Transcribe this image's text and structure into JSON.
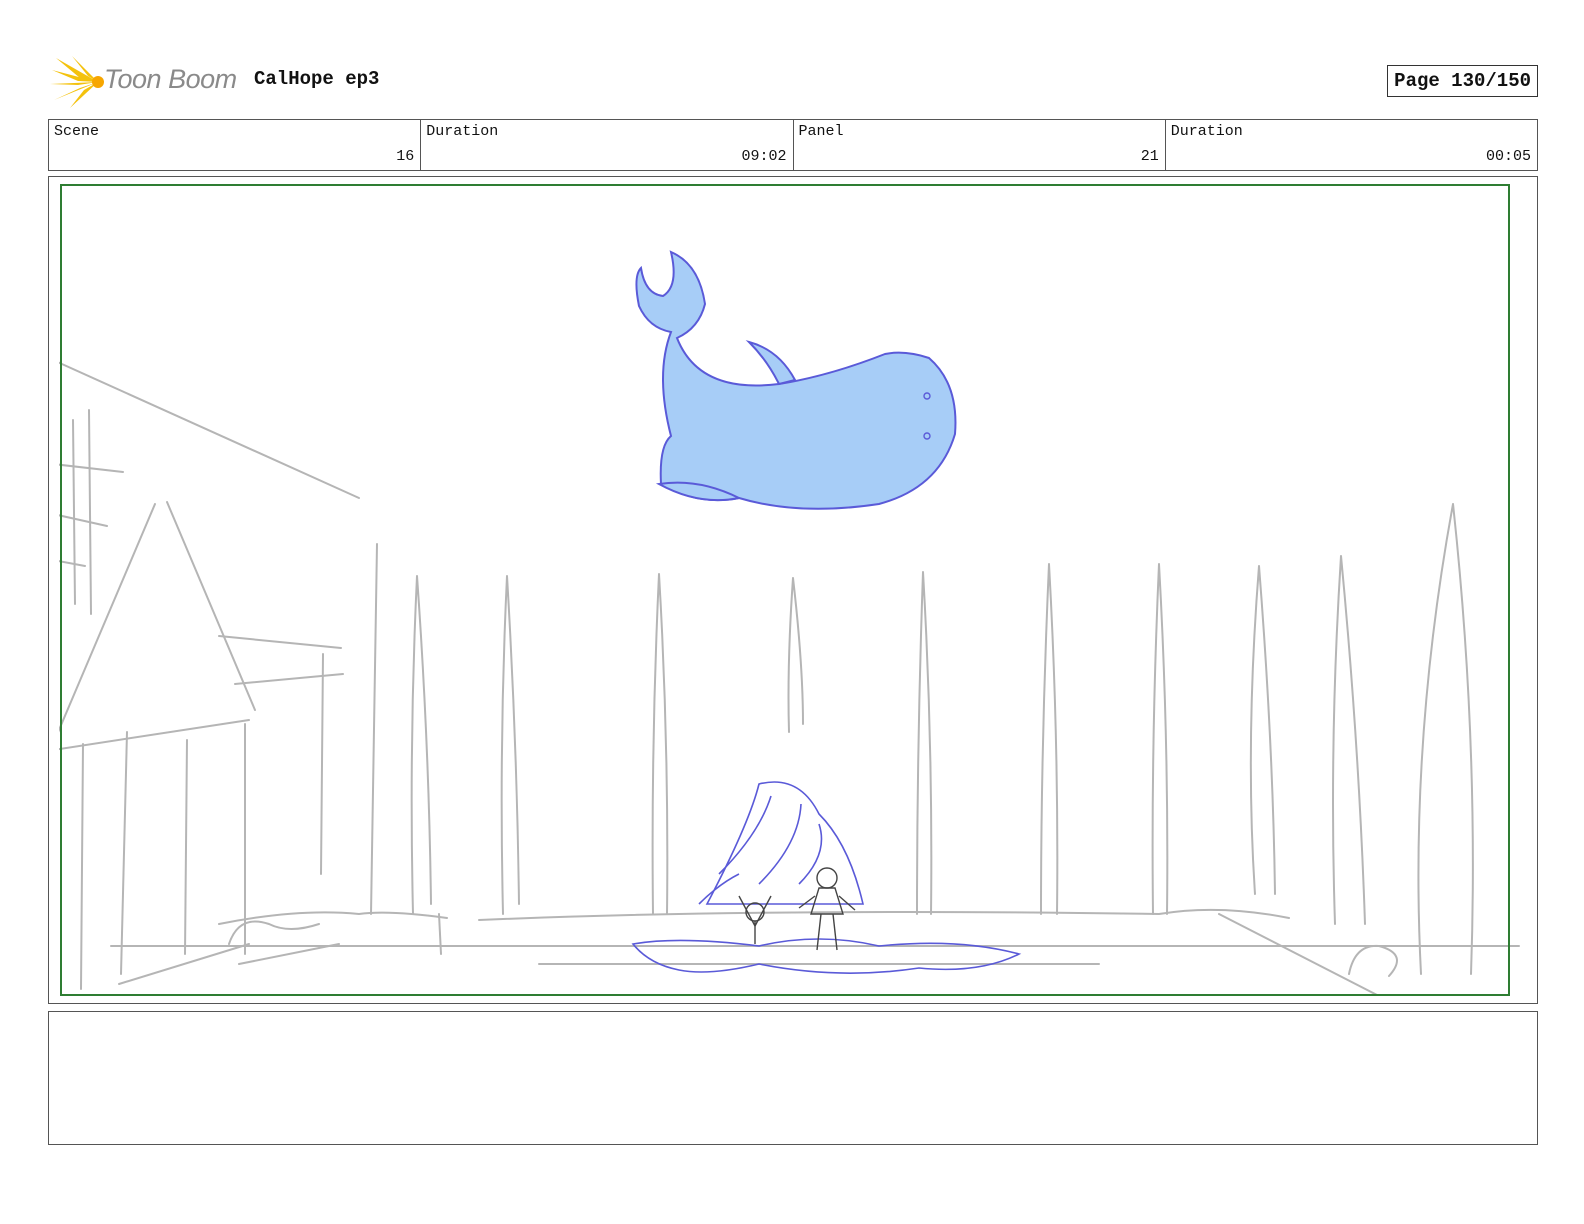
{
  "header": {
    "logo_text": "Toon Boom",
    "project_title": "CalHope ep3",
    "page_label": "Page 130/150"
  },
  "info": {
    "scene_label": "Scene",
    "scene_value": "16",
    "scene_duration_label": "Duration",
    "scene_duration_value": "09:02",
    "panel_label": "Panel",
    "panel_value": "21",
    "panel_duration_label": "Duration",
    "panel_duration_value": "00:05"
  },
  "panel": {
    "safe_frame_color": "#2e7d32",
    "sketch_color": "#b5b5b5",
    "whale_fill": "#a7cdf7",
    "whale_stroke": "#5a5ad8"
  },
  "notes": {
    "text": ""
  }
}
